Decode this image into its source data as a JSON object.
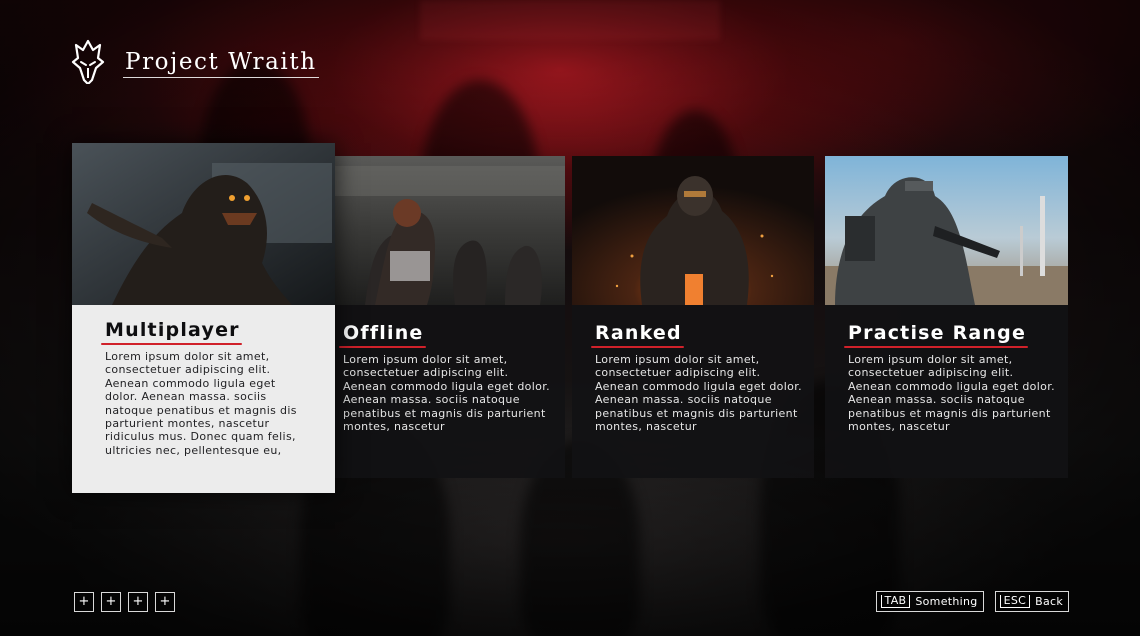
{
  "app": {
    "title": "Project Wraith",
    "logo_icon": "demon-mask-icon"
  },
  "colors": {
    "accent": "#d0212a",
    "selected_card_bg": "#ececec",
    "card_bg": "#121214"
  },
  "modes": [
    {
      "title": "Multiplayer",
      "description": "Lorem ipsum dolor sit amet, consectetuer adipiscing elit. Aenean commodo ligula eget dolor. Aenean massa.  sociis natoque penatibus et magnis dis parturient montes, nascetur ridiculus mus. Donec quam felis, ultricies nec, pellentesque eu,",
      "selected": true,
      "image": "werewolf-creature-art"
    },
    {
      "title": "Offline",
      "description": "Lorem ipsum dolor sit amet, consectetuer adipiscing elit. Aenean commodo ligula eget dolor. Aenean massa.  sociis natoque penatibus et magnis dis parturient montes, nascetur",
      "selected": false,
      "image": "zombie-crowd-art"
    },
    {
      "title": "Ranked",
      "description": "Lorem ipsum dolor sit amet, consectetuer adipiscing elit. Aenean commodo ligula eget dolor. Aenean massa.  sociis natoque penatibus et magnis dis parturient montes, nascetur",
      "selected": false,
      "image": "armored-soldier-embers-art"
    },
    {
      "title": "Practise Range",
      "description": "Lorem ipsum dolor sit amet, consectetuer adipiscing elit. Aenean commodo ligula eget dolor. Aenean massa.  sociis natoque penatibus et magnis dis parturient montes, nascetur",
      "selected": false,
      "image": "soldier-desert-range-art"
    }
  ],
  "footer": {
    "pager": [
      "+",
      "+",
      "+",
      "+"
    ],
    "hints": [
      {
        "key": "TAB",
        "label": "Something"
      },
      {
        "key": "ESC",
        "label": "Back"
      }
    ]
  }
}
